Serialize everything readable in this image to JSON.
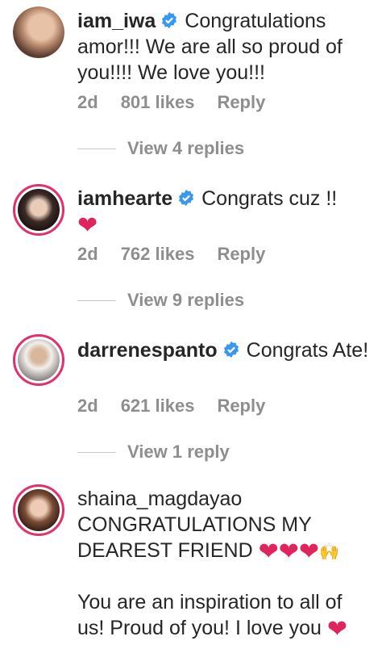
{
  "comments": [
    {
      "username": "iam_iwa",
      "verified": true,
      "text": "Congratulations amor!!! We are all so proud of you!!!! We love you!!!",
      "time": "2d",
      "likes": "801 likes",
      "reply": "Reply",
      "view_replies": "View 4 replies"
    },
    {
      "username": "iamhearte",
      "verified": true,
      "text": "Congrats cuz !!",
      "emoji": "❤",
      "time": "2d",
      "likes": "762 likes",
      "reply": "Reply",
      "view_replies": "View 9 replies"
    },
    {
      "username": "darrenespanto",
      "verified": true,
      "text": "Congrats Ate!",
      "time": "2d",
      "likes": "621 likes",
      "reply": "Reply",
      "view_replies": "View 1 reply"
    },
    {
      "username": "shaina_magdayao",
      "verified": false,
      "text_line1": "CONGRATULATIONS MY DEAREST FRIEND",
      "emoji_hearts": "❤❤❤",
      "emoji_hands": "🙌",
      "text_line2": "You are an inspiration to all of us! Proud of you! I love you",
      "emoji_end": "❤"
    }
  ],
  "colors": {
    "verified_blue": "#3897f0",
    "meta_gray": "#8e8e8e",
    "heart_red": "#e0245e",
    "ring": "#e1306c"
  }
}
